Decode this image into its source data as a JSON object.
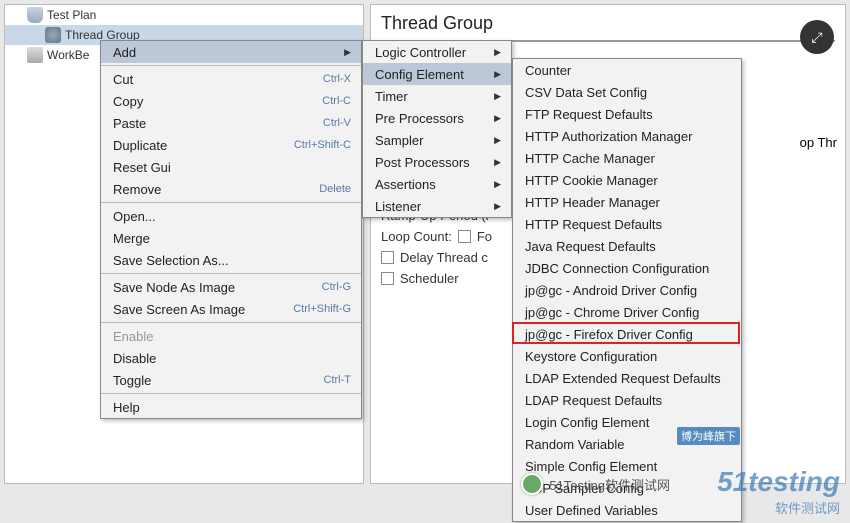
{
  "tree": {
    "items": [
      {
        "label": "Test Plan",
        "indent": 1,
        "icon": "flask"
      },
      {
        "label": "Thread Group",
        "indent": 2,
        "icon": "spool",
        "selected": true
      },
      {
        "label": "WorkBe",
        "indent": 1,
        "icon": "wb"
      }
    ]
  },
  "panel": {
    "title": "Thread Group",
    "rampup": "Ramp-Up Period (i",
    "loopCount": "Loop Count:",
    "forever": "Fo",
    "delay": "Delay Thread c",
    "scheduler": "Scheduler",
    "loopThr": "op Thr"
  },
  "ctx1": [
    {
      "label": "Add",
      "sub": true,
      "hl": true
    },
    null,
    {
      "label": "Cut",
      "shortcut": "Ctrl-X"
    },
    {
      "label": "Copy",
      "shortcut": "Ctrl-C"
    },
    {
      "label": "Paste",
      "shortcut": "Ctrl-V"
    },
    {
      "label": "Duplicate",
      "shortcut": "Ctrl+Shift-C"
    },
    {
      "label": "Reset Gui"
    },
    {
      "label": "Remove",
      "shortcut": "Delete"
    },
    null,
    {
      "label": "Open..."
    },
    {
      "label": "Merge"
    },
    {
      "label": "Save Selection As..."
    },
    null,
    {
      "label": "Save Node As Image",
      "shortcut": "Ctrl-G"
    },
    {
      "label": "Save Screen As Image",
      "shortcut": "Ctrl+Shift-G"
    },
    null,
    {
      "label": "Enable",
      "disabled": true
    },
    {
      "label": "Disable"
    },
    {
      "label": "Toggle",
      "shortcut": "Ctrl-T"
    },
    null,
    {
      "label": "Help"
    }
  ],
  "ctx2": [
    {
      "label": "Logic Controller",
      "sub": true
    },
    {
      "label": "Config Element",
      "sub": true,
      "hl": true
    },
    {
      "label": "Timer",
      "sub": true
    },
    {
      "label": "Pre Processors",
      "sub": true
    },
    {
      "label": "Sampler",
      "sub": true
    },
    {
      "label": "Post Processors",
      "sub": true
    },
    {
      "label": "Assertions",
      "sub": true
    },
    {
      "label": "Listener",
      "sub": true
    }
  ],
  "ctx3": [
    {
      "label": "Counter"
    },
    {
      "label": "CSV Data Set Config"
    },
    {
      "label": "FTP Request Defaults"
    },
    {
      "label": "HTTP Authorization Manager"
    },
    {
      "label": "HTTP Cache Manager"
    },
    {
      "label": "HTTP Cookie Manager"
    },
    {
      "label": "HTTP Header Manager"
    },
    {
      "label": "HTTP Request Defaults"
    },
    {
      "label": "Java Request Defaults"
    },
    {
      "label": "JDBC Connection Configuration"
    },
    {
      "label": "jp@gc - Android Driver Config"
    },
    {
      "label": "jp@gc - Chrome Driver Config"
    },
    {
      "label": "jp@gc - Firefox Driver Config",
      "boxed": true
    },
    {
      "label": "Keystore Configuration"
    },
    {
      "label": "LDAP Extended Request Defaults"
    },
    {
      "label": "LDAP Request Defaults"
    },
    {
      "label": "Login Config Element"
    },
    {
      "label": "Random Variable"
    },
    {
      "label": "Simple Config Element"
    },
    {
      "label": "TCP Sampler Config"
    },
    {
      "label": "User Defined Variables"
    }
  ],
  "watermark": {
    "logo": "51testing",
    "sub": "软件测试网",
    "badge": "博为峰旗下"
  },
  "wechat": {
    "label": "51Testing软件测试网"
  }
}
